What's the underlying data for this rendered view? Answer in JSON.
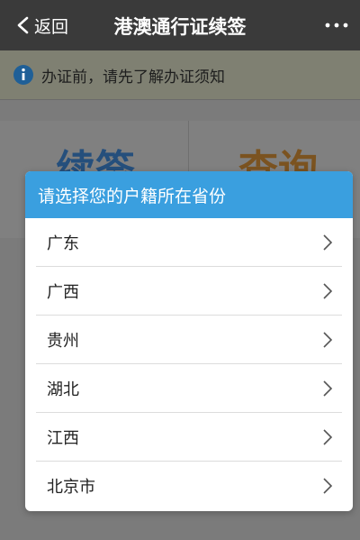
{
  "header": {
    "back_label": "返回",
    "title": "港澳通行证续签"
  },
  "notice": {
    "text": "办证前，请先了解办证须知"
  },
  "background_tabs": {
    "left": "续签",
    "right": "查询"
  },
  "modal": {
    "title": "请选择您的户籍所在省份",
    "items": [
      "广东",
      "广西",
      "贵州",
      "湖北",
      "江西",
      "北京市"
    ]
  },
  "colors": {
    "topbar": "#3a3a3a",
    "modal_header": "#3a9fdf",
    "overlay": "#7b7b7b"
  },
  "icons": {
    "back": "chevron-left-icon",
    "more": "more-dots-icon",
    "info": "info-icon",
    "row": "chevron-right-icon"
  }
}
